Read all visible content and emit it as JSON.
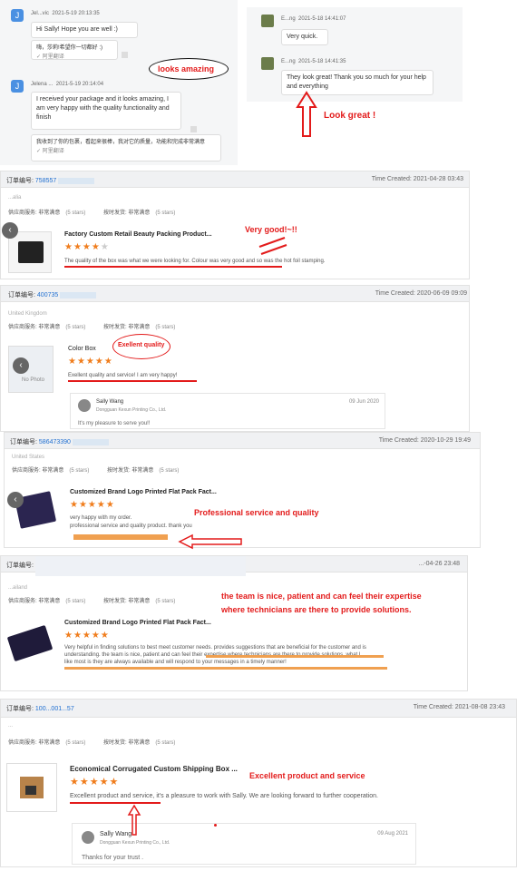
{
  "chat_left": {
    "msg1": {
      "name": "Jel...vic",
      "time": "2021-5-19 20:13:35",
      "text": "Hi Sally! Hope you are well :)",
      "translation": "嗨，莎莉!希望你一切都好 :)",
      "translated_tag": "✓ 阿里翻译"
    },
    "msg2": {
      "name": "Jelena ...",
      "time": "2021-5-19 20:14:04",
      "text": "I received your package and it looks amazing, I am very happy with the quality functionality and finish",
      "translation": "我收到了你的包裹，看起来很棒，我对它的质量，功能和完成非常满意",
      "translated_tag": "✓ 阿里翻译"
    },
    "note": "looks amazing"
  },
  "chat_right": {
    "msg1": {
      "name": "E...ng",
      "time": "2021-5-18 14:41:07",
      "text": "Very quick."
    },
    "msg2": {
      "name": "E...ng",
      "time": "2021-5-18 14:41:35",
      "text": "They look great! Thank you so much for your help and everything"
    },
    "note": "Look great !"
  },
  "reviews": [
    {
      "order_label": "订单编号:",
      "order_num": "758557",
      "time_created": "Time Created: 2021-04-28 03:43",
      "country": "...alia",
      "supplier_label": "供应商服务: 非常满意",
      "supplier_stars": "(5 stars)",
      "ship_label": "按时发货: 非常满意",
      "ship_stars": "(5 stars)",
      "product_title": "Factory Custom Retail Beauty Packing Product...",
      "stars": "★★★★★",
      "review_text": "The quality of the box was what we were looking for. Colour was very good and so was the hot foil stamping.",
      "note": "Very good!~!!"
    },
    {
      "order_label": "订单编号:",
      "order_num": "400735",
      "time_created": "Time Created: 2020-06-09 09:09",
      "country": "United Kingdom",
      "supplier_label": "供应商服务: 非常满意",
      "supplier_stars": "(5 stars)",
      "ship_label": "按时发货: 非常满意",
      "ship_stars": "(5 stars)",
      "product_title": "Color Box",
      "stars": "★★★★★",
      "review_text": "Exellent quality and service! I am very happy!",
      "note": "Exellent quality",
      "reply": {
        "name": "Sally Wang",
        "company": "Dongguan Kexun Printing Co., Ltd.",
        "date": "09 Jun 2020",
        "text": "It's my pleasure to serve you!!"
      }
    },
    {
      "order_label": "订单编号:",
      "order_num": "586473390",
      "time_created": "Time Created: 2020-10-29 19:49",
      "country": "United States",
      "supplier_label": "供应商服务: 非常满意",
      "supplier_stars": "(5 stars)",
      "ship_label": "按时发货: 非常满意",
      "ship_stars": "(5 stars)",
      "product_title": "Customized Brand Logo Printed Flat Pack Fact...",
      "stars": "★★★★★",
      "review_line1": "very happy with my order.",
      "review_line2": "professional service and quality product. thank you",
      "note": "Professional service and quality"
    },
    {
      "order_label": "订单编号:",
      "time_created": "...-04-26 23:48",
      "country": "...ailand",
      "supplier_label": "供应商服务: 非常满意",
      "supplier_stars": "(5 stars)",
      "ship_label": "按时发货: 非常满意",
      "ship_stars": "(5 stars)",
      "product_title": "Customized Brand Logo Printed Flat Pack Fact...",
      "stars": "★★★★★",
      "review_text": "Very helpful in finding solutions to best meet customer needs. provides suggestions that are beneficial for the customer and is understanding. the team is nice, patient and can feel their expertise where technicians are there to provide solutions. what I like most is they are always available and will respond to your messages in a timely manner!",
      "note": "the team is nice, patient and can feel their expertise where technicians are there to provide solutions."
    },
    {
      "order_label": "订单编号:",
      "order_num": "100...001...57",
      "time_created": "Time Created: 2021-08-08 23:43",
      "country": "...",
      "supplier_label": "供应商服务: 非常满意",
      "supplier_stars": "(5 stars)",
      "ship_label": "按时发货: 非常满意",
      "ship_stars": "(5 stars)",
      "product_title": "Economical Corrugated Custom Shipping Box ...",
      "stars": "★★★★★",
      "review_text": "Excellent product and service, it's a pleasure to work with Sally. We are looking forward to further cooperation.",
      "note": "Excellent product and service",
      "reply": {
        "name": "Sally Wang",
        "company": "Dongguan Kexun Printing Co., Ltd.",
        "date": "09 Aug 2021",
        "text": "Thanks for your trust ."
      }
    }
  ],
  "colors": {
    "annotation_red": "#e31b1b",
    "star_orange": "#f07d1d",
    "highlight_orange": "#f0a050",
    "link_blue": "#1f6fd1"
  }
}
